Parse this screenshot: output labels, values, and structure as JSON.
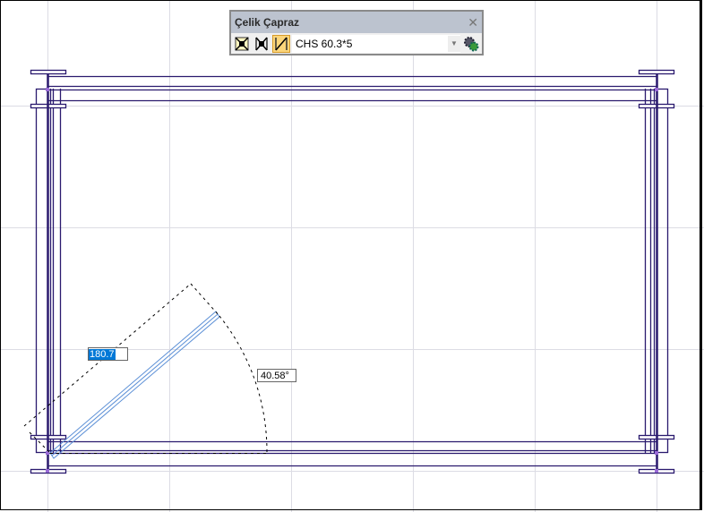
{
  "toolbar": {
    "title": "Çelik Çapraz",
    "close_icon": "close-icon",
    "buttons": [
      {
        "name": "x-brace-icon",
        "active": false
      },
      {
        "name": "k-brace-icon",
        "active": false
      },
      {
        "name": "single-diagonal-brace-icon",
        "active": true
      }
    ],
    "section_value": "CHS 60.3*5",
    "settings_icon": "gear-icon"
  },
  "drawing": {
    "length_input": "180.7",
    "angle_input": "40.58°"
  },
  "colors": {
    "member": "#2a1a6e",
    "brace_preview": "#5b8fd6",
    "grid": "#dcdce4",
    "selection": "#0078d7"
  }
}
